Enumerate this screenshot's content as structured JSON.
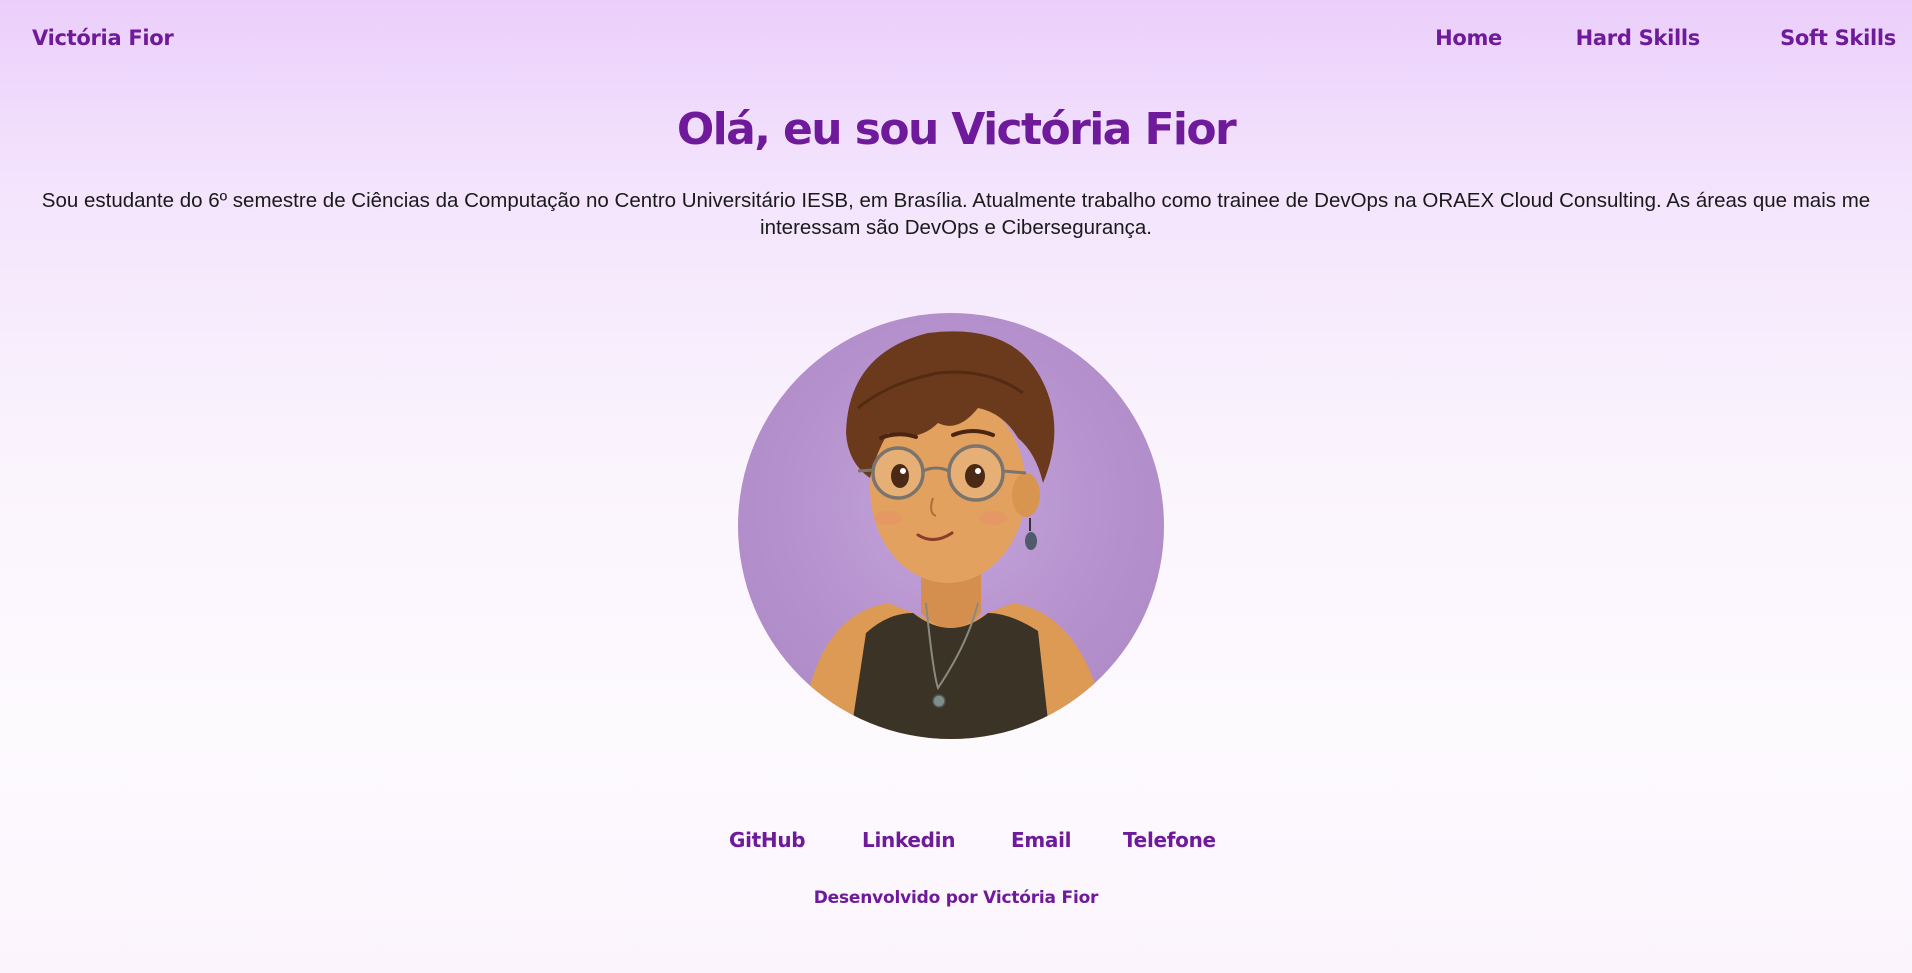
{
  "header": {
    "brand": "Victória Fior",
    "nav": [
      "Home",
      "Hard Skills",
      "Soft Skills"
    ]
  },
  "hero": {
    "title": "Olá, eu sou Victória Fior",
    "bio": "Sou estudante do 6º semestre de Ciências da Computação no Centro Universitário IESB, em Brasília. Atualmente trabalho como trainee de DevOps na ORAEX Cloud Consulting. As áreas que mais me interessam são DevOps e Cibersegurança."
  },
  "social_links": [
    "GitHub",
    "Linkedin",
    "Email",
    "Telefone"
  ],
  "footer": {
    "text": "Desenvolvido por Victória Fior"
  },
  "colors": {
    "accent": "#6e1a9a",
    "avatar_bg": "#b38fcb"
  }
}
